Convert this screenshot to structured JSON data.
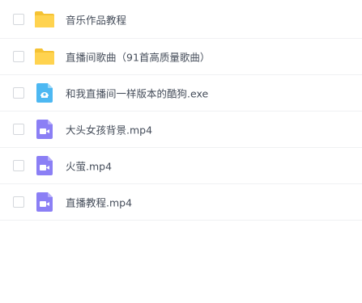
{
  "files": [
    {
      "name": "音乐作品教程",
      "type": "folder-icon"
    },
    {
      "name": "直播间歌曲（91首高质量歌曲）",
      "type": "folder-icon"
    },
    {
      "name": "和我直播间一样版本的酷狗.exe",
      "type": "exe-icon"
    },
    {
      "name": "大头女孩背景.mp4",
      "type": "video-icon"
    },
    {
      "name": "火萤.mp4",
      "type": "video-icon"
    },
    {
      "name": "直播教程.mp4",
      "type": "video-icon"
    }
  ],
  "colors": {
    "folder": "#ffd34f",
    "folder_tab": "#f5c233",
    "video": "#8b7ff5",
    "exe": "#4db8f2",
    "text": "#454d5a",
    "divider": "#f0f1f3"
  }
}
